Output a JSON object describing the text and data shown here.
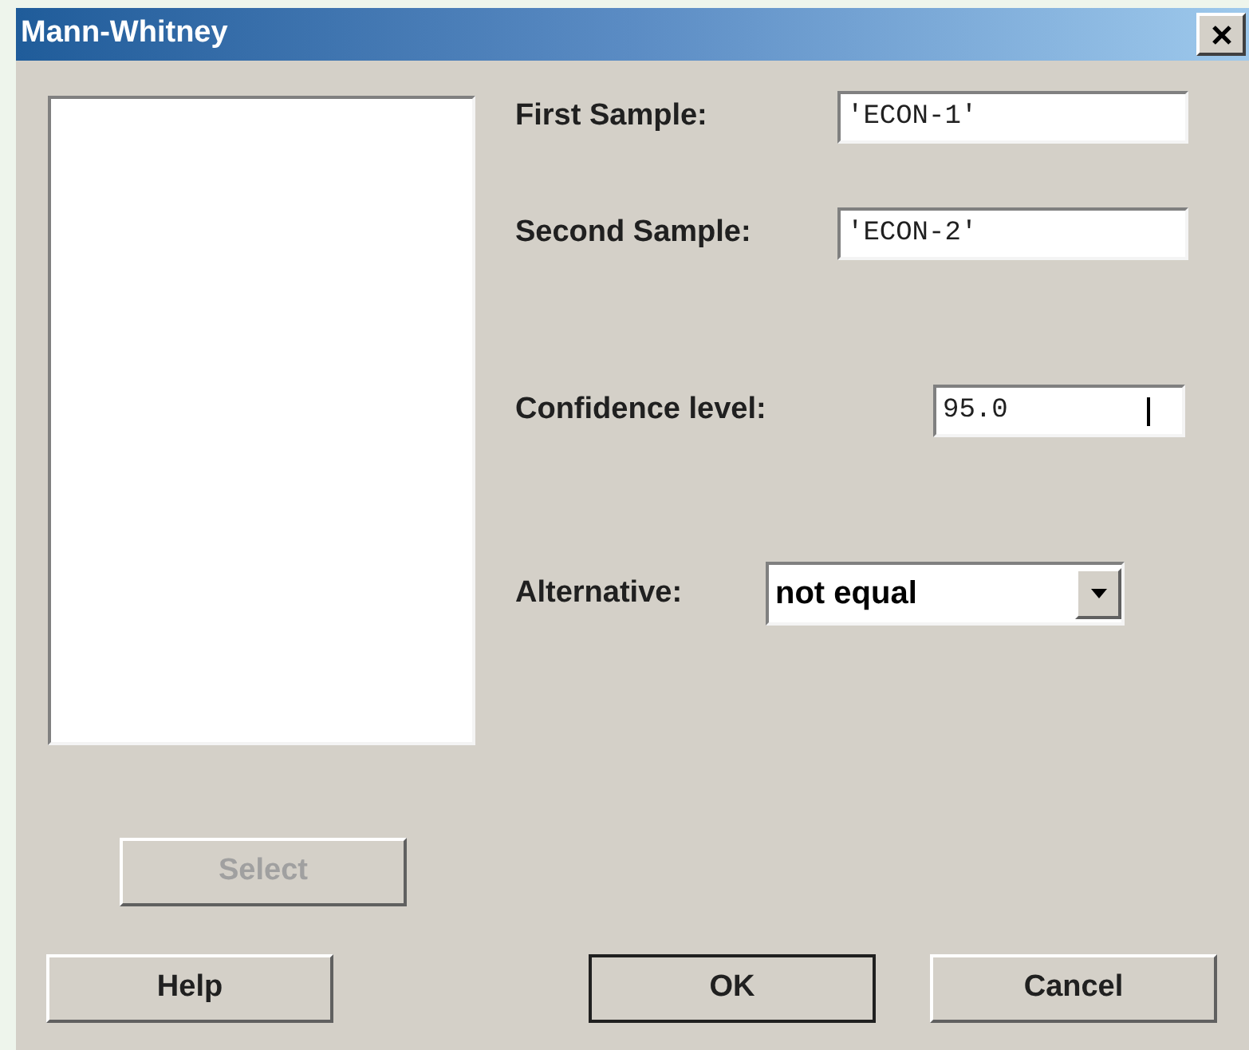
{
  "window": {
    "title": "Mann-Whitney"
  },
  "fields": [
    {
      "label": "First Sample:",
      "value": "'ECON-1'"
    },
    {
      "label": "Second Sample:",
      "value": "'ECON-2'"
    },
    {
      "label": "Confidence level:",
      "value": "95.0"
    }
  ],
  "alternative": {
    "label": "Alternative:",
    "value": "not equal"
  },
  "select_button": {
    "label": "Select",
    "disabled": true
  },
  "buttons": [
    {
      "label": "Help",
      "default": false
    },
    {
      "label": "OK",
      "default": true
    },
    {
      "label": "Cancel",
      "default": false
    }
  ]
}
